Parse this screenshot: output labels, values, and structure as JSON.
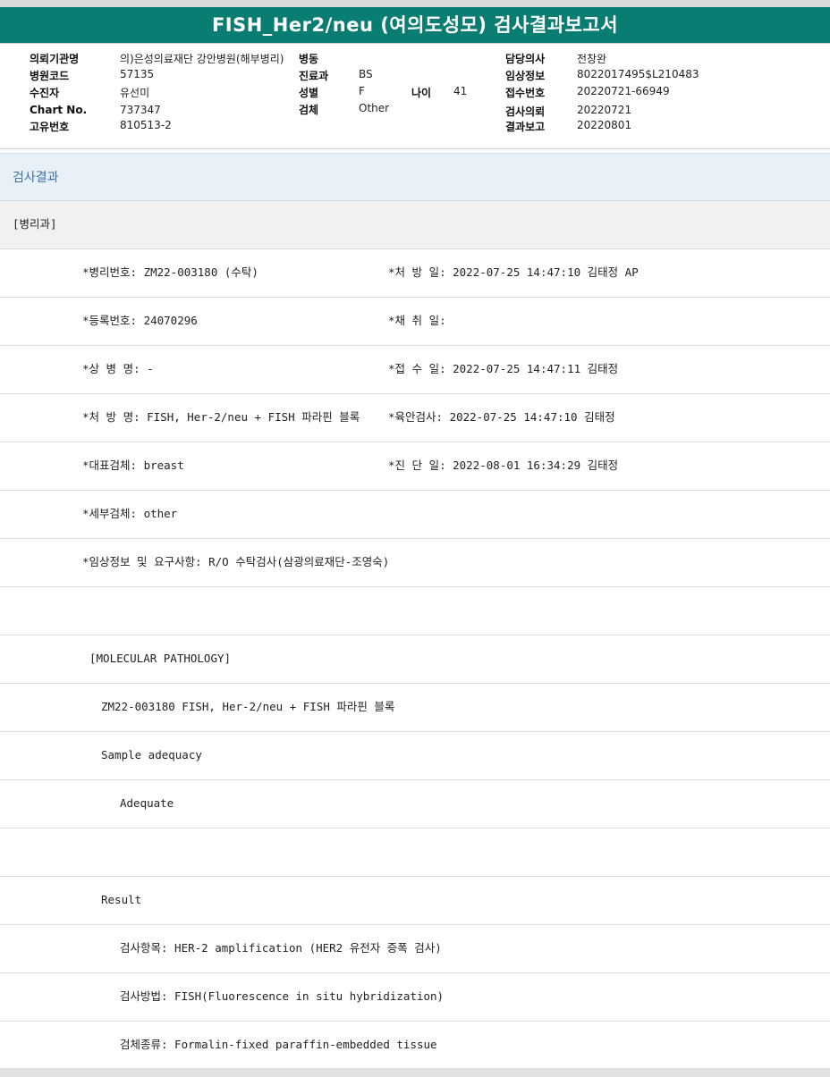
{
  "title": "FISH_Her2/neu (여의도성모) 검사결과보고서",
  "header": {
    "col1": [
      {
        "label": "의뢰기관명",
        "value": "의)은성의료재단 강안병원(해부병리)"
      },
      {
        "label": "병원코드",
        "value": "57135"
      },
      {
        "label": "수진자",
        "value": "유선미"
      },
      {
        "label": "Chart No.",
        "value": "737347"
      },
      {
        "label": "고유번호",
        "value": "810513-2"
      }
    ],
    "col2": [
      {
        "label": "병동",
        "value": ""
      },
      {
        "label": "진료과",
        "value": "BS"
      },
      {
        "label": "성별",
        "value": "F"
      },
      {
        "label": "검체",
        "value": "Other"
      }
    ],
    "age": {
      "label": "나이",
      "value": "41"
    },
    "col3": [
      {
        "label": "담당의사",
        "value": "전창완"
      },
      {
        "label": "임상정보",
        "value": "8022017495$L210483"
      },
      {
        "label": "접수번호",
        "value": "20220721-66949"
      },
      {
        "label": "검사의뢰",
        "value": "20220721"
      },
      {
        "label": "결과보고",
        "value": "20220801"
      }
    ]
  },
  "section_title": "검사결과",
  "department": "[병리과]",
  "rows": [
    {
      "left": "*병리번호: ZM22-003180 (수탁)",
      "right": "*처 방 일: 2022-07-25 14:47:10  김태정 AP"
    },
    {
      "left": "*등록번호: 24070296",
      "right": "*채 취 일:"
    },
    {
      "left": "*상 병 명: -",
      "right": "*접 수 일: 2022-07-25 14:47:11  김태정"
    },
    {
      "left": "*처 방 명: FISH, Her-2/neu + FISH 파라핀 블록",
      "right": "*육안검사: 2022-07-25 14:47:10  김태정"
    },
    {
      "left": "*대표검체: breast",
      "right": "*진 단 일: 2022-08-01 16:34:29  김태정"
    },
    {
      "left": "*세부검체: other",
      "right": ""
    },
    {
      "left": "*임상정보 및 요구사항: R/O 수탁검사(삼광의료재단-조영숙)",
      "right": ""
    }
  ],
  "report": {
    "blank1": "",
    "molecular_header": "[MOLECULAR PATHOLOGY]",
    "case_line": "ZM22-003180     FISH, Her-2/neu + FISH 파라핀 블록",
    "sample_adequacy_label": "Sample adequacy",
    "adequacy_value": "Adequate",
    "blank2": "",
    "result_label": "Result",
    "test_item": "검사항목: HER-2 amplification (HER2 유전자 증폭 검사)",
    "test_method": "검사방법: FISH(Fluorescence in situ hybridization)",
    "specimen_type": "검체종류: Formalin-fixed paraffin-embedded tissue"
  }
}
